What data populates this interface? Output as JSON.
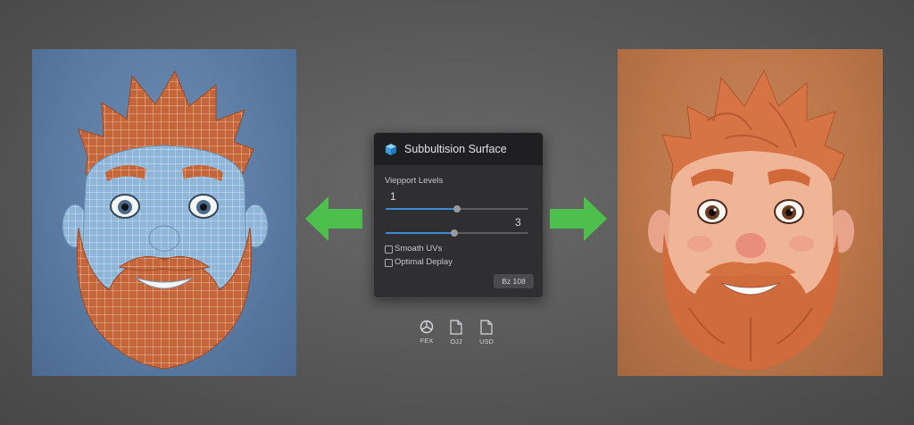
{
  "dialog": {
    "title": "Subbultision Surface",
    "viewport_label": "Viepport Levels",
    "viewport_value": "1",
    "viewport_fraction": 0.5,
    "render_value": "3",
    "render_fraction": 0.48,
    "checkbox1_label": "Smoath UVs",
    "checkbox1_checked": false,
    "checkbox2_label": "Optimal Deplay",
    "checkbox2_checked": false,
    "ok_label": "Bz 108"
  },
  "formats": [
    "FEX",
    "OJJ",
    "USD"
  ],
  "colors": {
    "accent": "#3d8bd8",
    "arrow": "#4cbf4c",
    "wire_orange": "#c8643a",
    "wire_blue": "#9cc4e0"
  }
}
